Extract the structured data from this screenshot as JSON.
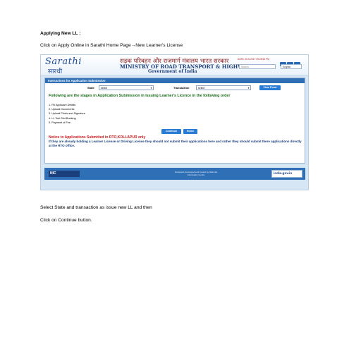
{
  "doc": {
    "heading": "Applying New LL :",
    "instruction_part1": "Click on Apply Online in Sarathi Home Page",
    "arrow": "→",
    "instruction_part2": "New Learner's License",
    "bottom_line1": "Select State and transaction as issue new LL and then",
    "bottom_line2": "Click on Continue button."
  },
  "screenshot": {
    "logo_script": "Sarathi",
    "logo_hindi": "सारथी",
    "hindi_title": "सड़क परिवहन और राजमार्ग मंत्रालय भारत सरकार",
    "ministry_title": "MINISTRY OF ROAD TRANSPORT & HIGHWAYS",
    "gov_title": "Government of India",
    "date_text": "DATE: 20-5-2017 09:28:52 PM",
    "search_placeholder": "Search",
    "language": "English",
    "panel_title": "Instructions for Application Submission",
    "state_label": "State",
    "state_value": "select",
    "transaction_label": "Transaction",
    "transaction_value": "select",
    "view_button": "View Form",
    "stages_heading": "Following are the stages in Application Submission in Issuing Learner's Licence in the following order",
    "steps": [
      "1. Fill Applicant Details",
      "2. Upload Documents",
      "3. Upload Photo and Signature",
      "4. LL Test Slot Booking",
      "5. Payment of Fee"
    ],
    "continue_button": "Continue",
    "home_button": "Home",
    "notice": "Notice to Applications Submitted to RTO,KOLLAPUR only",
    "notice_note": "If they are already holding a Learner License or Driving License they should not submit their applications here and rather they should submit there applications directly at the RTO office.",
    "footer_logo": "NIC",
    "footer_credit": "Designed, developed and hosted by National Informatics Centre",
    "india_logo": "india.gov.in"
  },
  "colors": {
    "accent_blue": "#2f6fb5",
    "stage_green": "#1a6b1a",
    "notice_red": "#c61a1a"
  }
}
